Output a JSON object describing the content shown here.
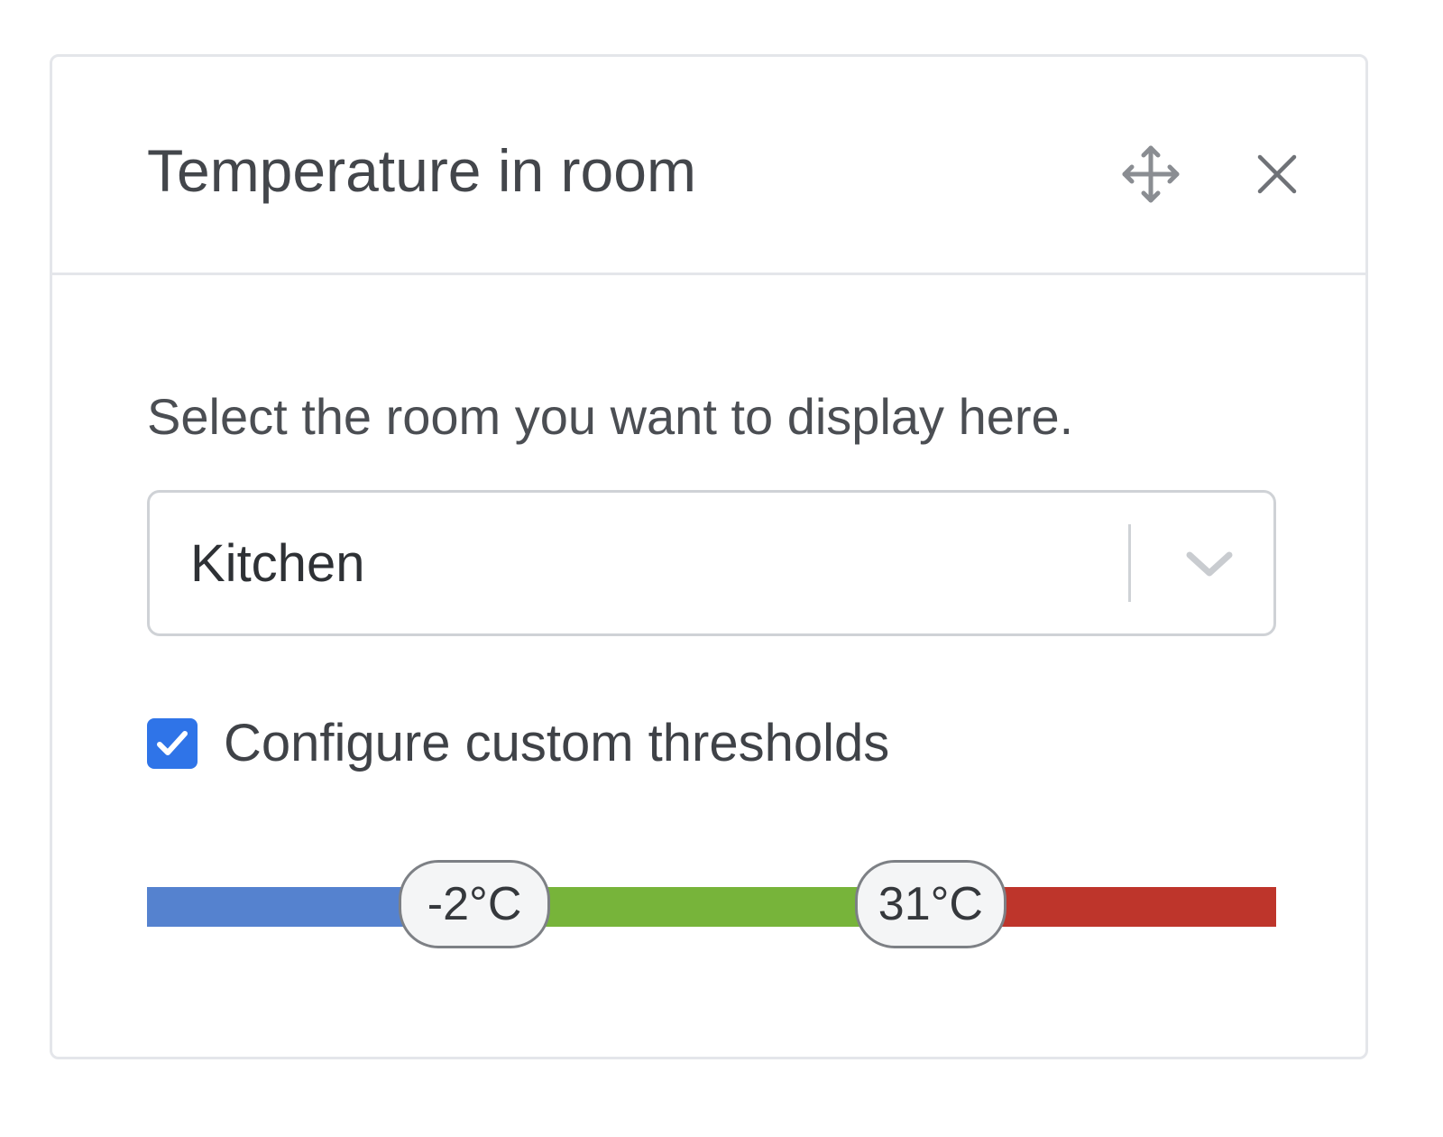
{
  "widget": {
    "title": "Temperature in room",
    "actions": {
      "move_icon": "move-arrows-icon",
      "close_icon": "close-icon"
    }
  },
  "room_select": {
    "description": "Select the room you want to display here.",
    "selected": "Kitchen",
    "chevron_icon": "chevron-down-icon"
  },
  "thresholds": {
    "checkbox_label": "Configure custom thresholds",
    "checked": true,
    "low_label": "-2°C",
    "high_label": "31°C",
    "low_fraction": 0.29,
    "high_fraction": 0.694,
    "colors": {
      "cold": "#5582cf",
      "ok": "#77b43a",
      "hot": "#be352b",
      "checkbox": "#2f74e8"
    }
  }
}
